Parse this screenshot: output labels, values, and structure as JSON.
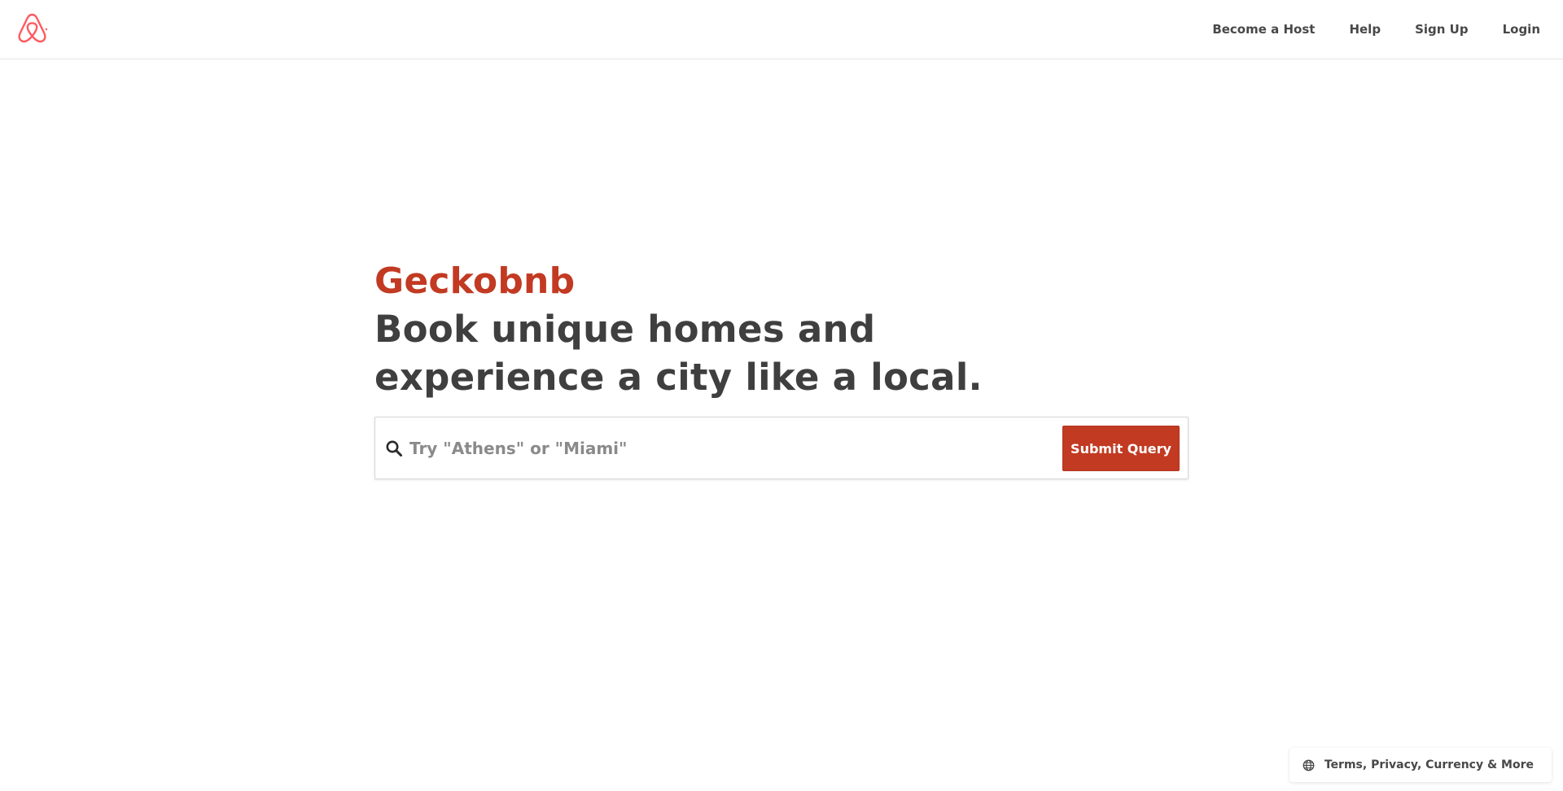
{
  "header": {
    "logo_icon": "airbnb-belo-logo-icon",
    "nav": [
      {
        "label": "Become a Host"
      },
      {
        "label": "Help"
      },
      {
        "label": "Sign Up"
      },
      {
        "label": "Login"
      }
    ]
  },
  "hero": {
    "brand": "Geckobnb",
    "tagline_line1": "Book unique homes and",
    "tagline_line2": "experience a city like a local."
  },
  "search": {
    "icon": "search-icon",
    "placeholder": "Try \"Athens\" or \"Miami\"",
    "value": "",
    "submit_label": "Submit Query"
  },
  "footer": {
    "icon": "globe-icon",
    "label": "Terms, Privacy, Currency & More"
  },
  "colors": {
    "brand": "#c23a22",
    "logo": "#ff5a5f",
    "text": "#484848",
    "border": "#e4e4e4"
  }
}
